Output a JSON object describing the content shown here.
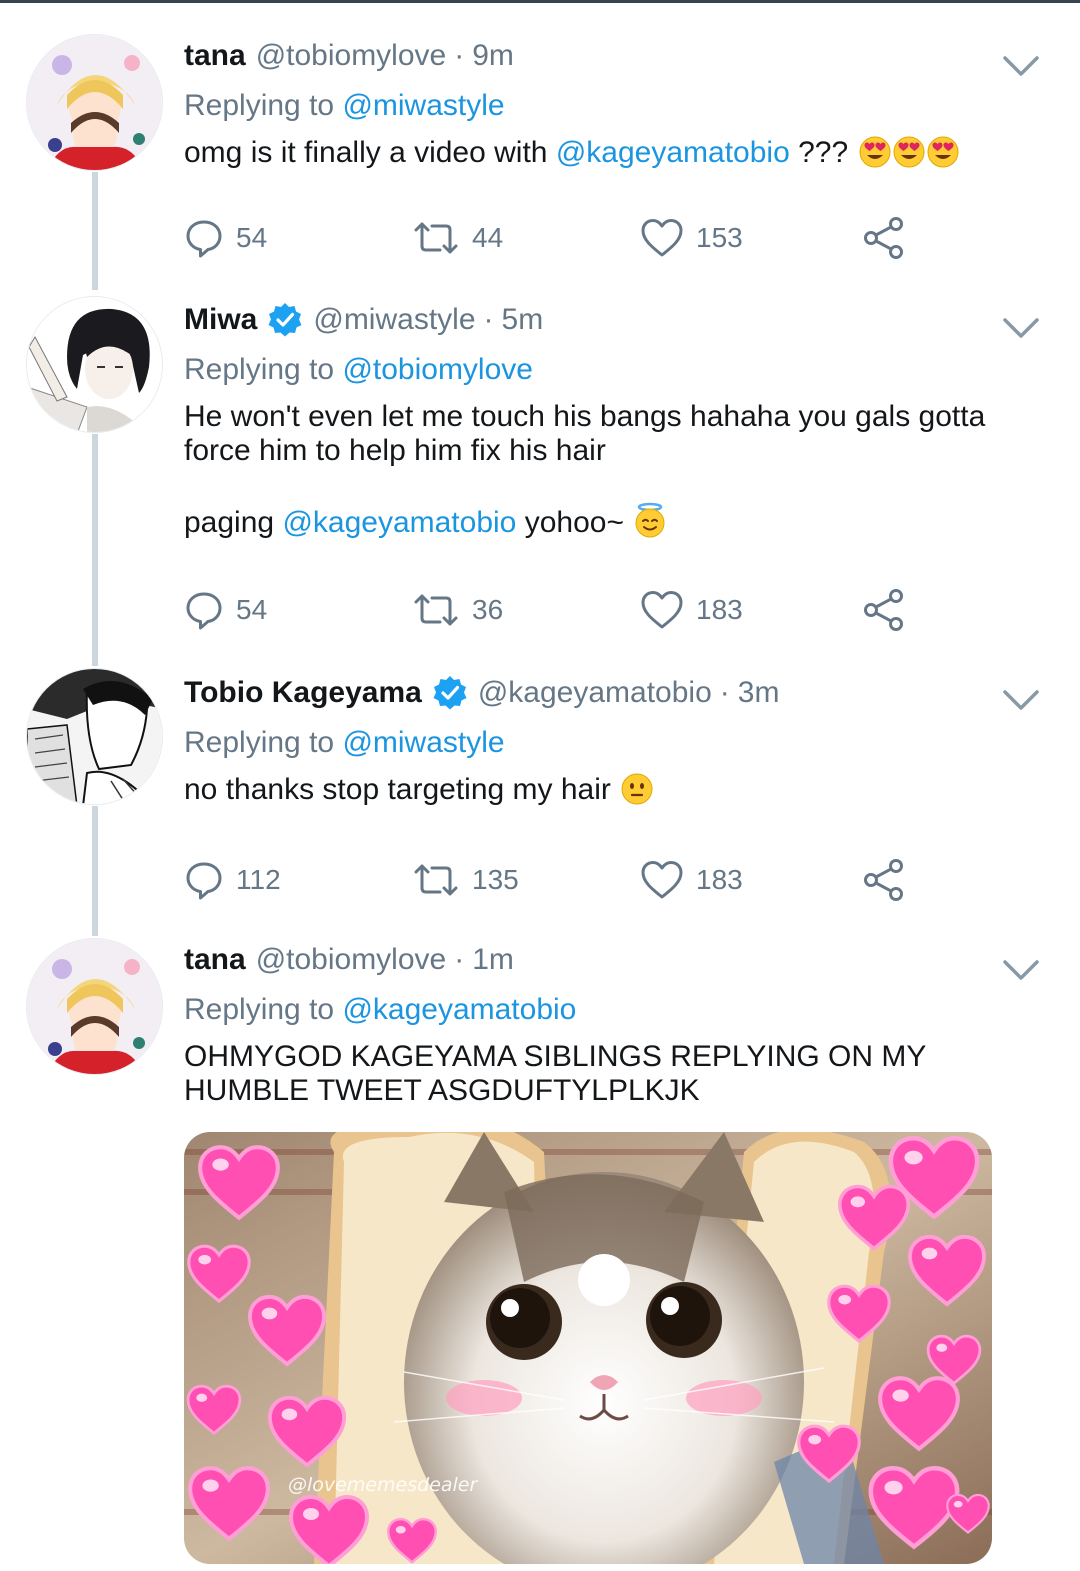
{
  "tweets": [
    {
      "name": "tana",
      "handle": "@tobiomylove",
      "time": "9m",
      "replying_prefix": "Replying to",
      "replying_to": "@miwastyle",
      "text_before": "omg is it finally a video with",
      "text_mention": "@kageyamatobio",
      "text_after": "???",
      "emojis": [
        "heart-eyes",
        "heart-eyes",
        "heart-eyes"
      ],
      "replies": "54",
      "retweets": "44",
      "likes": "153"
    },
    {
      "name": "Miwa",
      "verified": true,
      "handle": "@miwastyle",
      "time": "5m",
      "replying_prefix": "Replying to",
      "replying_to": "@tobiomylove",
      "text_line1": "He won't even let me touch his bangs hahaha you gals gotta force him to help him fix his hair",
      "text2_before": "paging",
      "text2_mention": "@kageyamatobio",
      "text2_after": "yohoo~",
      "emoji": "halo-smile",
      "replies": "54",
      "retweets": "36",
      "likes": "183"
    },
    {
      "name": "Tobio Kageyama",
      "verified": true,
      "handle": "@kageyamatobio",
      "time": "3m",
      "replying_prefix": "Replying to",
      "replying_to": "@miwastyle",
      "text": "no thanks stop targeting my hair",
      "emoji": "neutral-face",
      "replies": "112",
      "retweets": "135",
      "likes": "183"
    },
    {
      "name": "tana",
      "handle": "@tobiomylove",
      "time": "1m",
      "replying_prefix": "Replying to",
      "replying_to": "@kageyamatobio",
      "text": "OHMYGOD KAGEYAMA SIBLINGS REPLYING ON MY HUMBLE TWEET ASGDUFTYLPLKJK",
      "media_watermark": "@lovememesdealer"
    }
  ],
  "colors": {
    "accent": "#1b95e0",
    "muted": "#657786",
    "verified": "#1da1f2",
    "thread_line": "#ccd6dd"
  },
  "icons": [
    "reply-icon",
    "retweet-icon",
    "like-icon",
    "share-icon",
    "chevron-down-icon",
    "verified-badge-icon"
  ]
}
